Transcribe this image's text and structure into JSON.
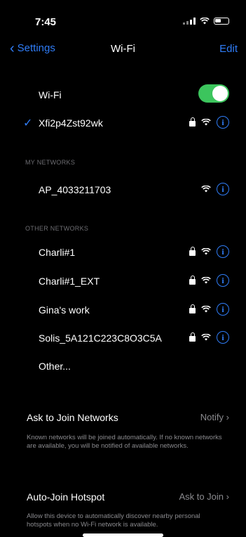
{
  "status": {
    "time": "7:45"
  },
  "nav": {
    "back_label": "Settings",
    "title": "Wi-Fi",
    "edit_label": "Edit"
  },
  "wifi": {
    "label": "Wi-Fi",
    "enabled": true
  },
  "connected": {
    "name": "Xfi2p4Zst92wk",
    "secured": true
  },
  "my_networks": {
    "header": "MY NETWORKS",
    "items": [
      {
        "name": "AP_4033211703",
        "secured": false
      }
    ]
  },
  "other_networks": {
    "header": "OTHER NETWORKS",
    "items": [
      {
        "name": "Charli#1",
        "secured": true
      },
      {
        "name": "Charli#1_EXT",
        "secured": true
      },
      {
        "name": "Gina's work",
        "secured": true
      },
      {
        "name": "Solis_5A121C223C8O3C5A",
        "secured": true
      }
    ],
    "other_label": "Other..."
  },
  "ask_to_join": {
    "label": "Ask to Join Networks",
    "value": "Notify",
    "footnote": "Known networks will be joined automatically. If no known networks are available, you will be notified of available networks."
  },
  "auto_join": {
    "label": "Auto-Join Hotspot",
    "value": "Ask to Join",
    "footnote": "Allow this device to automatically discover nearby personal hotspots when no Wi-Fi network is available."
  },
  "colors": {
    "accent": "#2f7cf6",
    "toggle_on": "#3cc55d",
    "background": "#000000",
    "secondary_text": "#8a8a8e"
  },
  "icons": {
    "lock": "lock-icon",
    "wifi": "wifi-icon",
    "info": "info-icon",
    "check": "checkmark-icon",
    "back": "chevron-left-icon",
    "disclosure": "chevron-right-icon"
  }
}
